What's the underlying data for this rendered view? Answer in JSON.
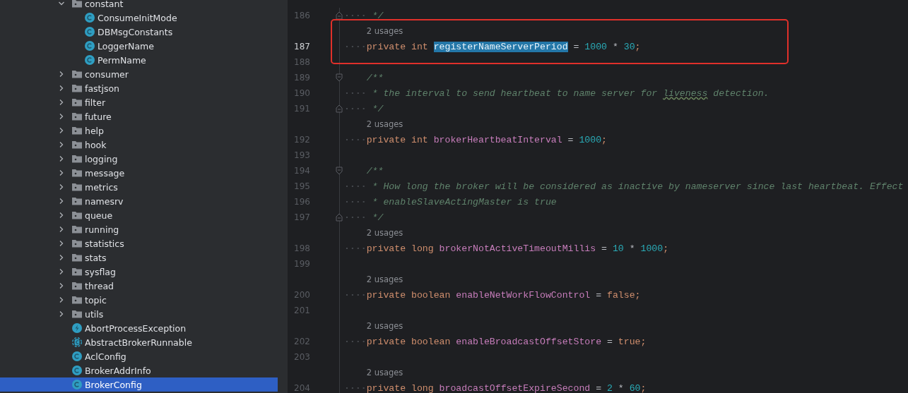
{
  "project_tree": [
    {
      "name": "constant",
      "kind": "folder",
      "expanded": true,
      "selected": false,
      "children": [
        {
          "name": "ConsumeInitMode",
          "kind": "class",
          "selected": false
        },
        {
          "name": "DBMsgConstants",
          "kind": "class",
          "selected": false
        },
        {
          "name": "LoggerName",
          "kind": "class",
          "selected": false
        },
        {
          "name": "PermName",
          "kind": "class",
          "selected": false
        }
      ]
    },
    {
      "name": "consumer",
      "kind": "folder",
      "expanded": false,
      "selected": false
    },
    {
      "name": "fastjson",
      "kind": "folder",
      "expanded": false,
      "selected": false
    },
    {
      "name": "filter",
      "kind": "folder",
      "expanded": false,
      "selected": false
    },
    {
      "name": "future",
      "kind": "folder",
      "expanded": false,
      "selected": false
    },
    {
      "name": "help",
      "kind": "folder",
      "expanded": false,
      "selected": false
    },
    {
      "name": "hook",
      "kind": "folder",
      "expanded": false,
      "selected": false
    },
    {
      "name": "logging",
      "kind": "folder",
      "expanded": false,
      "selected": false
    },
    {
      "name": "message",
      "kind": "folder",
      "expanded": false,
      "selected": false
    },
    {
      "name": "metrics",
      "kind": "folder",
      "expanded": false,
      "selected": false
    },
    {
      "name": "namesrv",
      "kind": "folder",
      "expanded": false,
      "selected": false
    },
    {
      "name": "queue",
      "kind": "folder",
      "expanded": false,
      "selected": false
    },
    {
      "name": "running",
      "kind": "folder",
      "expanded": false,
      "selected": false
    },
    {
      "name": "statistics",
      "kind": "folder",
      "expanded": false,
      "selected": false
    },
    {
      "name": "stats",
      "kind": "folder",
      "expanded": false,
      "selected": false
    },
    {
      "name": "sysflag",
      "kind": "folder",
      "expanded": false,
      "selected": false
    },
    {
      "name": "thread",
      "kind": "folder",
      "expanded": false,
      "selected": false
    },
    {
      "name": "topic",
      "kind": "folder",
      "expanded": false,
      "selected": false
    },
    {
      "name": "utils",
      "kind": "folder",
      "expanded": false,
      "selected": false
    },
    {
      "name": "AbortProcessException",
      "kind": "exception",
      "selected": false
    },
    {
      "name": "AbstractBrokerRunnable",
      "kind": "abstract",
      "selected": false
    },
    {
      "name": "AclConfig",
      "kind": "class",
      "selected": false
    },
    {
      "name": "BrokerAddrInfo",
      "kind": "class",
      "selected": false
    },
    {
      "name": "BrokerConfig",
      "kind": "class",
      "selected": true
    }
  ],
  "editor": {
    "blocks": [
      {
        "boxed": false,
        "lines": [
          {
            "kind": "code",
            "number": "186",
            "fold_end": true,
            "indent_dots": true,
            "current": false,
            "tokens": [
              {
                "kind": "comment",
                "text": " */"
              }
            ]
          }
        ]
      },
      {
        "boxed": true,
        "lines": [
          {
            "kind": "usages",
            "text": "2 usages"
          },
          {
            "kind": "code",
            "number": "187",
            "indent_dots": true,
            "current": true,
            "tokens": [
              {
                "kind": "keyword",
                "text": "private int "
              },
              {
                "kind": "selected",
                "text": "registerNameServerPeriod"
              },
              {
                "kind": "op",
                "text": " = "
              },
              {
                "kind": "number",
                "text": "1000"
              },
              {
                "kind": "op",
                "text": " * "
              },
              {
                "kind": "number",
                "text": "30"
              },
              {
                "kind": "punct",
                "text": ";"
              }
            ]
          },
          {
            "kind": "code",
            "number": "188",
            "current": false
          }
        ]
      },
      {
        "boxed": false,
        "lines": [
          {
            "kind": "code",
            "number": "189",
            "fold_start": true,
            "indent_dots": false,
            "current": false,
            "tokens": [
              {
                "kind": "comment",
                "text": "/**"
              }
            ]
          },
          {
            "kind": "code",
            "number": "190",
            "indent_dots": true,
            "current": false,
            "tokens": [
              {
                "kind": "comment",
                "text": " * the interval to send heartbeat to name server for "
              },
              {
                "kind": "typo",
                "text": "liveness"
              },
              {
                "kind": "comment",
                "text": " detection."
              }
            ]
          },
          {
            "kind": "code",
            "number": "191",
            "fold_end": true,
            "indent_dots": true,
            "current": false,
            "tokens": [
              {
                "kind": "comment",
                "text": " */"
              }
            ]
          },
          {
            "kind": "usages",
            "text": "2 usages"
          },
          {
            "kind": "code",
            "number": "192",
            "indent_dots": true,
            "current": false,
            "tokens": [
              {
                "kind": "keyword",
                "text": "private int "
              },
              {
                "kind": "field",
                "text": "brokerHeartbeatInterval"
              },
              {
                "kind": "op",
                "text": " = "
              },
              {
                "kind": "number",
                "text": "1000"
              },
              {
                "kind": "punct",
                "text": ";"
              }
            ]
          },
          {
            "kind": "code",
            "number": "193",
            "current": false
          },
          {
            "kind": "code",
            "number": "194",
            "fold_start": true,
            "indent_dots": false,
            "current": false,
            "tokens": [
              {
                "kind": "comment",
                "text": "/**"
              }
            ]
          },
          {
            "kind": "code",
            "number": "195",
            "indent_dots": true,
            "current": false,
            "tokens": [
              {
                "kind": "comment",
                "text": " * How long the broker will be considered as inactive by nameserver since last heartbeat. Effect"
              }
            ]
          },
          {
            "kind": "code",
            "number": "196",
            "indent_dots": true,
            "current": false,
            "tokens": [
              {
                "kind": "comment",
                "text": " * enableSlaveActingMaster is true"
              }
            ]
          },
          {
            "kind": "code",
            "number": "197",
            "fold_end": true,
            "indent_dots": true,
            "current": false,
            "tokens": [
              {
                "kind": "comment",
                "text": " */"
              }
            ]
          },
          {
            "kind": "usages",
            "text": "2 usages"
          },
          {
            "kind": "code",
            "number": "198",
            "indent_dots": true,
            "current": false,
            "tokens": [
              {
                "kind": "keyword",
                "text": "private long "
              },
              {
                "kind": "field",
                "text": "brokerNotActiveTimeoutMillis"
              },
              {
                "kind": "op",
                "text": " = "
              },
              {
                "kind": "number",
                "text": "10"
              },
              {
                "kind": "op",
                "text": " * "
              },
              {
                "kind": "number",
                "text": "1000"
              },
              {
                "kind": "punct",
                "text": ";"
              }
            ]
          },
          {
            "kind": "code",
            "number": "199",
            "current": false
          },
          {
            "kind": "usages",
            "text": "2 usages"
          },
          {
            "kind": "code",
            "number": "200",
            "indent_dots": true,
            "current": false,
            "tokens": [
              {
                "kind": "keyword",
                "text": "private boolean "
              },
              {
                "kind": "field",
                "text": "enableNetWorkFlowControl"
              },
              {
                "kind": "op",
                "text": " = "
              },
              {
                "kind": "keyword",
                "text": "false"
              },
              {
                "kind": "punct",
                "text": ";"
              }
            ]
          },
          {
            "kind": "code",
            "number": "201",
            "current": false
          },
          {
            "kind": "usages",
            "text": "2 usages"
          },
          {
            "kind": "code",
            "number": "202",
            "indent_dots": true,
            "current": false,
            "tokens": [
              {
                "kind": "keyword",
                "text": "private boolean "
              },
              {
                "kind": "field",
                "text": "enableBroadcastOffsetStore"
              },
              {
                "kind": "op",
                "text": " = "
              },
              {
                "kind": "keyword",
                "text": "true"
              },
              {
                "kind": "punct",
                "text": ";"
              }
            ]
          },
          {
            "kind": "code",
            "number": "203",
            "current": false
          },
          {
            "kind": "usages",
            "text": "2 usages"
          },
          {
            "kind": "code",
            "number": "204",
            "indent_dots": true,
            "current": false,
            "tokens": [
              {
                "kind": "keyword",
                "text": "private long "
              },
              {
                "kind": "field",
                "text": "broadcastOffsetExpireSecond"
              },
              {
                "kind": "op",
                "text": " = "
              },
              {
                "kind": "number",
                "text": "2"
              },
              {
                "kind": "op",
                "text": " * "
              },
              {
                "kind": "number",
                "text": "60"
              },
              {
                "kind": "punct",
                "text": ";"
              }
            ]
          }
        ]
      }
    ]
  }
}
